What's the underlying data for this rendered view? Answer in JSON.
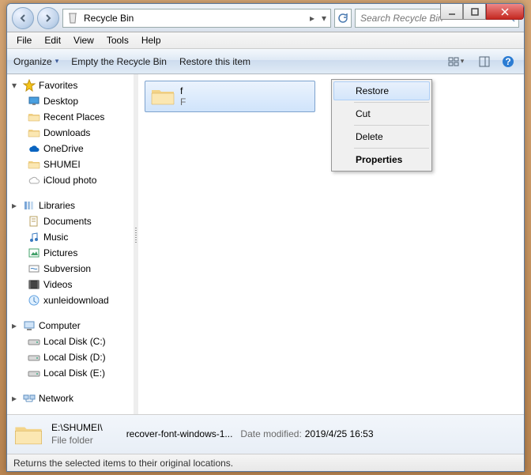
{
  "title_buttons": {
    "min": "min",
    "max": "max",
    "close": "close"
  },
  "address": {
    "location": "Recycle Bin",
    "chevron": "▸",
    "dropdown": "▾"
  },
  "search": {
    "placeholder": "Search Recycle Bin"
  },
  "menu": {
    "file": "File",
    "edit": "Edit",
    "view": "View",
    "tools": "Tools",
    "help": "Help"
  },
  "toolbar": {
    "organize": "Organize",
    "organize_arrow": "▾",
    "empty": "Empty the Recycle Bin",
    "restore": "Restore this item",
    "view_arrow": "▾"
  },
  "sidebar": {
    "favorites": {
      "label": "Favorites",
      "items": [
        {
          "label": "Desktop"
        },
        {
          "label": "Recent Places"
        },
        {
          "label": "Downloads"
        },
        {
          "label": "OneDrive"
        },
        {
          "label": "SHUMEI"
        },
        {
          "label": "iCloud photo"
        }
      ]
    },
    "libraries": {
      "label": "Libraries",
      "items": [
        {
          "label": "Documents"
        },
        {
          "label": "Music"
        },
        {
          "label": "Pictures"
        },
        {
          "label": "Subversion"
        },
        {
          "label": "Videos"
        },
        {
          "label": "xunleidownload"
        }
      ]
    },
    "computer": {
      "label": "Computer",
      "items": [
        {
          "label": "Local Disk (C:)"
        },
        {
          "label": "Local Disk (D:)"
        },
        {
          "label": "Local Disk (E:)"
        }
      ]
    },
    "network": {
      "label": "Network"
    }
  },
  "file": {
    "name_vis": "f",
    "sub_vis": "F"
  },
  "contextmenu": {
    "restore": "Restore",
    "cut": "Cut",
    "delete": "Delete",
    "properties": "Properties"
  },
  "details": {
    "path": "E:\\SHUMEI\\",
    "type": "File folder",
    "orig_name": "recover-font-windows-1...",
    "mod_label": "Date modified:",
    "mod_value": "2019/4/25 16:53"
  },
  "statusbar": {
    "text": "Returns the selected items to their original locations."
  }
}
